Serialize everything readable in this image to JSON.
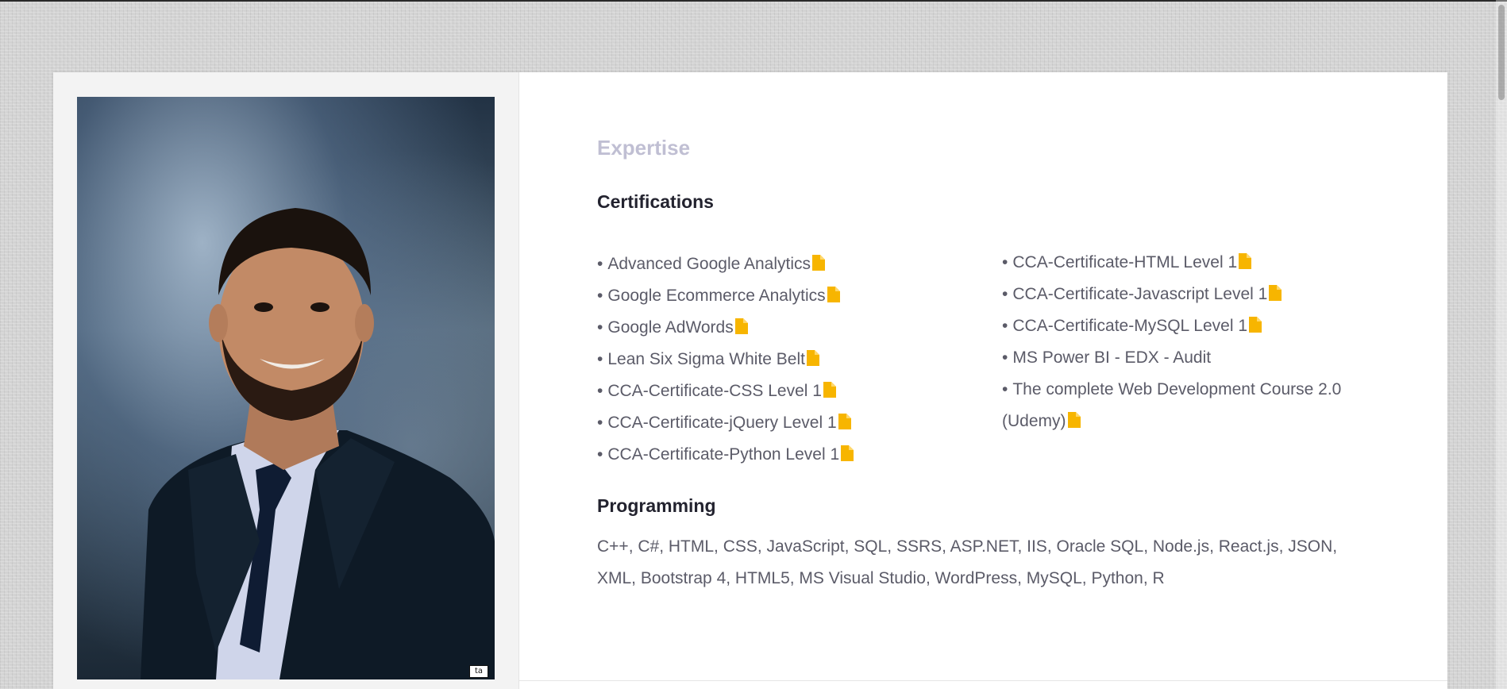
{
  "expertise": {
    "section_label": "Expertise",
    "certifications_heading": "Certifications",
    "certifications_left": [
      "Advanced Google Analytics",
      "Google Ecommerce Analytics",
      "Google AdWords",
      "Lean Six Sigma White Belt",
      "CCA-Certificate-CSS Level 1",
      "CCA-Certificate-jQuery Level 1",
      "CCA-Certificate-Python Level 1"
    ],
    "certifications_right": [
      "CCA-Certificate-HTML Level 1",
      "CCA-Certificate-Javascript Level 1",
      "CCA-Certificate-MySQL Level 1",
      "MS Power BI - EDX - Audit",
      "The complete Web Development Course 2.0 (Udemy)"
    ],
    "bullet": "•",
    "programming_heading": "Programming",
    "programming_text": "C++, C#, HTML, CSS, JavaScript, SQL, SSRS, ASP.NET, IIS, Oracle SQL, Node.js, React.js, JSON, XML, Bootstrap 4, HTML5, MS Visual Studio, WordPress, MySQL, Python, R"
  },
  "photo": {
    "watermark": "ta"
  },
  "icons": {
    "certificate_link": "document-icon"
  },
  "colors": {
    "doc_icon": "#f7b500",
    "heading": "#23232f",
    "section_label": "#c0bfd3",
    "body_text": "#5b5b68"
  }
}
